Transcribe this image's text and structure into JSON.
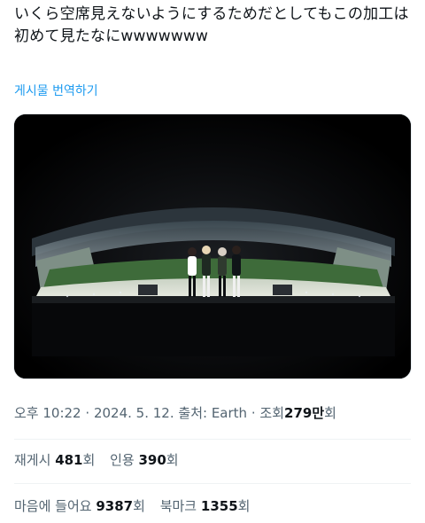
{
  "tweet": {
    "text": "いくら空席見えないようにするためだとしてもこの加工は初めて見たなにwwwwwww",
    "translate_label": "게시물 번역하기"
  },
  "meta": {
    "time": "오후 10:22",
    "sep1": "·",
    "date": "2024. 5. 12.",
    "source_label": "출처:",
    "source": "Earth",
    "sep2": "·",
    "views_label": "조회",
    "views_count": "279만",
    "views_suffix": "회"
  },
  "stats": {
    "reposts_label": "재게시",
    "reposts_count": "481",
    "reposts_suffix": "회",
    "quotes_label": "인용",
    "quotes_count": "390",
    "quotes_suffix": "회",
    "likes_label": "마음에 들어요",
    "likes_count": "9387",
    "likes_suffix": "회",
    "bookmarks_label": "북마크",
    "bookmarks_count": "1355",
    "bookmarks_suffix": "회"
  },
  "colors": {
    "link": "#1d9bf0",
    "secondary_text": "#536471",
    "primary_text": "#0f1419"
  }
}
